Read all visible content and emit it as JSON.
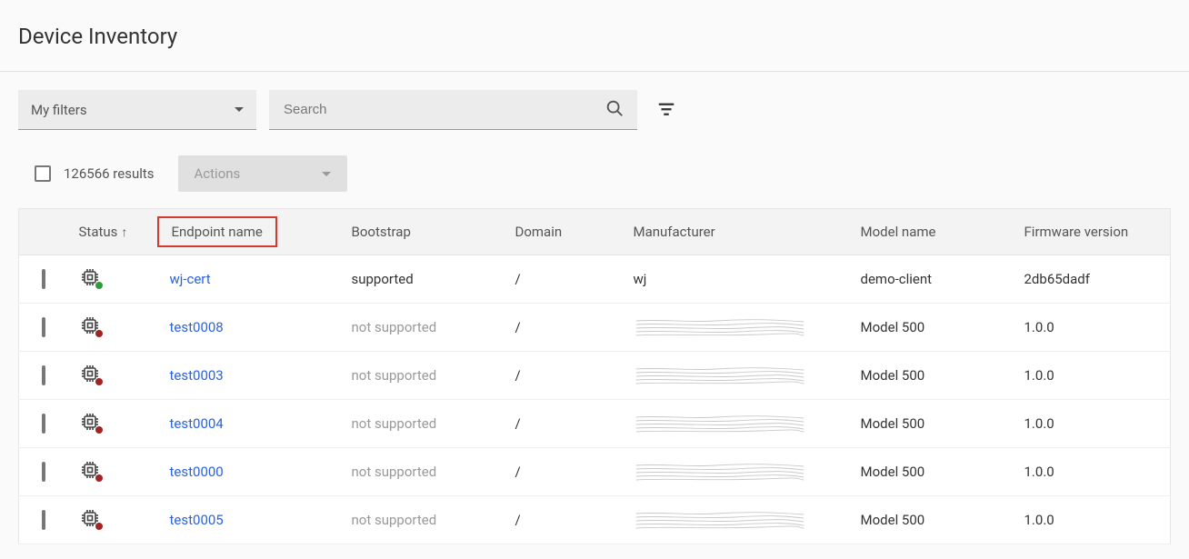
{
  "page_title": "Device Inventory",
  "filters_label": "My filters",
  "search_placeholder": "Search",
  "results_count": "126566 results",
  "actions_label": "Actions",
  "columns": {
    "status": "Status",
    "endpoint": "Endpoint name",
    "bootstrap": "Bootstrap",
    "domain": "Domain",
    "manufacturer": "Manufacturer",
    "model": "Model name",
    "firmware": "Firmware version"
  },
  "rows": [
    {
      "status": "online",
      "endpoint": "wj-cert",
      "bootstrap": "supported",
      "domain": "/",
      "manufacturer": "wj",
      "model": "demo-client",
      "firmware": "2db65dadf"
    },
    {
      "status": "offline",
      "endpoint": "test0008",
      "bootstrap": "not supported",
      "domain": "/",
      "manufacturer": "(redacted)",
      "model": "Model 500",
      "firmware": "1.0.0"
    },
    {
      "status": "offline",
      "endpoint": "test0003",
      "bootstrap": "not supported",
      "domain": "/",
      "manufacturer": "(redacted)",
      "model": "Model 500",
      "firmware": "1.0.0"
    },
    {
      "status": "offline",
      "endpoint": "test0004",
      "bootstrap": "not supported",
      "domain": "/",
      "manufacturer": "(redacted)",
      "model": "Model 500",
      "firmware": "1.0.0"
    },
    {
      "status": "offline",
      "endpoint": "test0000",
      "bootstrap": "not supported",
      "domain": "/",
      "manufacturer": "(redacted)",
      "model": "Model 500",
      "firmware": "1.0.0"
    },
    {
      "status": "offline",
      "endpoint": "test0005",
      "bootstrap": "not supported",
      "domain": "/",
      "manufacturer": "(redacted)",
      "model": "Model 500",
      "firmware": "1.0.0"
    }
  ]
}
